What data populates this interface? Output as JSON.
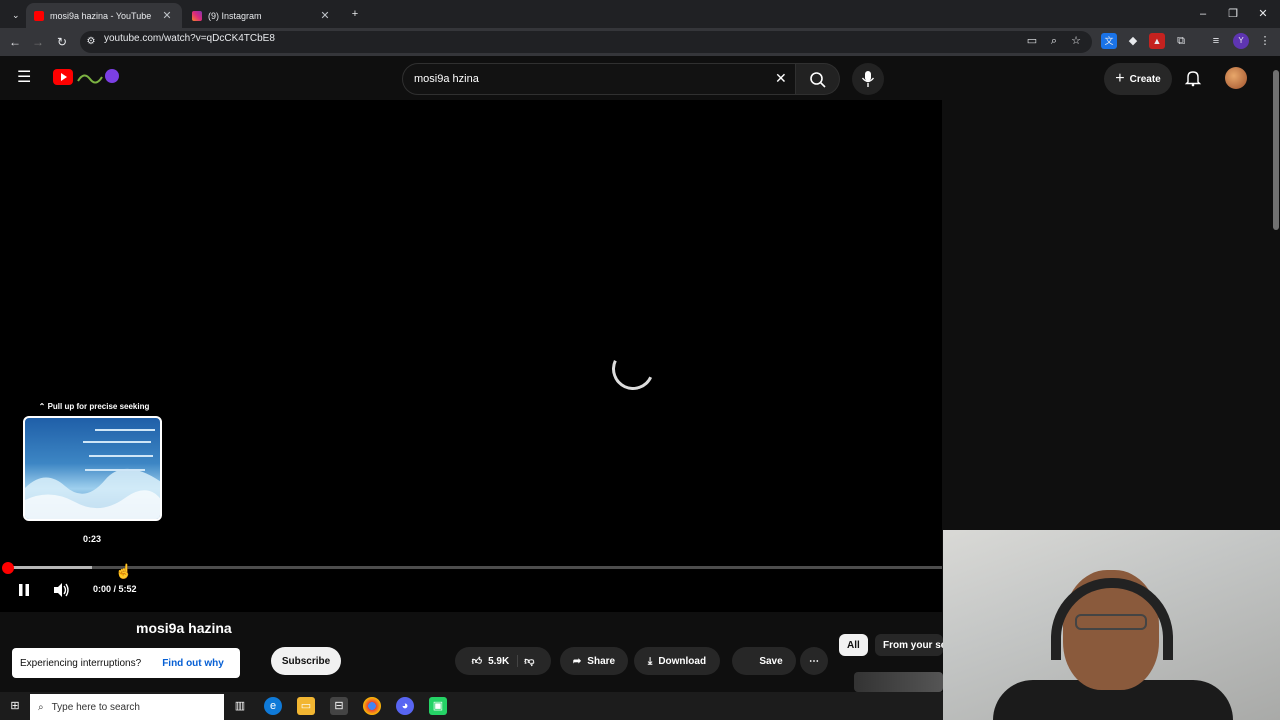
{
  "browser": {
    "tabs": [
      {
        "title": "mosi9a hazina - YouTube",
        "active": true
      },
      {
        "title": "(9) Instagram",
        "active": false
      }
    ],
    "url": "youtube.com/watch?v=qDcCK4TCbE8"
  },
  "youtube": {
    "search_value": "mosi9a hzina",
    "create_label": "Create"
  },
  "player": {
    "seek_hint": "Pull up for precise seeking",
    "preview_time": "0:23",
    "time_display": "0:00 / 5:52",
    "played_fraction": 0.0,
    "hover_fraction": 0.09
  },
  "video_info": {
    "title": "mosi9a hazina",
    "subscribe_label": "Subscribe",
    "likes": "5.9K",
    "share_label": "Share",
    "download_label": "Download",
    "save_label": "Save"
  },
  "notice": {
    "text": "Experiencing interruptions?",
    "link": "Find out why"
  },
  "chips": {
    "all": "All",
    "from_channel": "From your se"
  },
  "taskbar": {
    "search_placeholder": "Type here to search"
  },
  "colors": {
    "accent": "#ff0000",
    "background": "#0f0f0f",
    "link": "#065fd4"
  }
}
